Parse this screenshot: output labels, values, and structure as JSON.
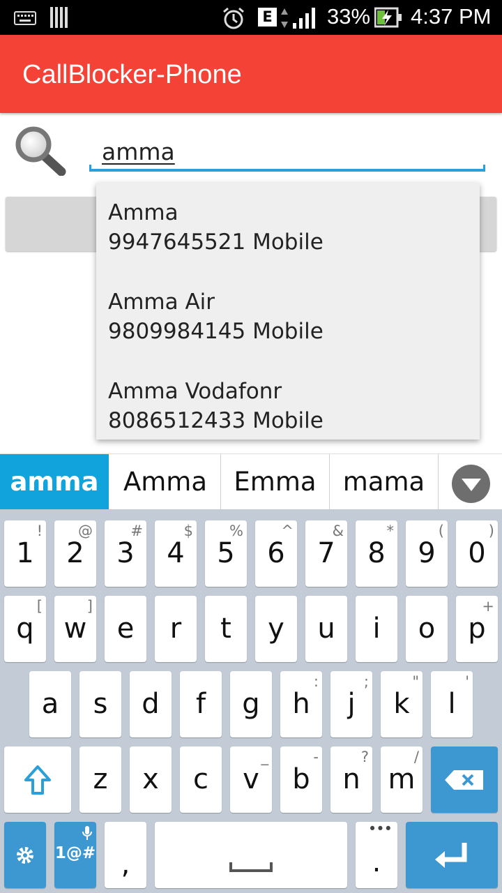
{
  "status_bar": {
    "battery": "33%",
    "time": "4:37 PM",
    "network_badge": "E"
  },
  "app": {
    "title": "CallBlocker-Phone"
  },
  "search": {
    "value": "amma"
  },
  "suggestions": [
    {
      "name": "Amma",
      "phone": "9947645521 Mobile"
    },
    {
      "name": "Amma Air",
      "phone": "9809984145 Mobile"
    },
    {
      "name": "Amma Vodafonr",
      "phone": "8086512433 Mobile"
    }
  ],
  "word_suggestions": [
    "amma",
    "Amma",
    "Emma",
    "mama"
  ],
  "keyboard": {
    "row1": [
      {
        "k": "1",
        "h": "!"
      },
      {
        "k": "2",
        "h": "@"
      },
      {
        "k": "3",
        "h": "#"
      },
      {
        "k": "4",
        "h": "$"
      },
      {
        "k": "5",
        "h": "%"
      },
      {
        "k": "6",
        "h": "^"
      },
      {
        "k": "7",
        "h": "&"
      },
      {
        "k": "8",
        "h": "*"
      },
      {
        "k": "9",
        "h": "("
      },
      {
        "k": "0",
        "h": ")"
      }
    ],
    "row2": [
      {
        "k": "q",
        "h": "["
      },
      {
        "k": "w",
        "h": "]"
      },
      {
        "k": "e",
        "h": ""
      },
      {
        "k": "r",
        "h": ""
      },
      {
        "k": "t",
        "h": ""
      },
      {
        "k": "y",
        "h": ""
      },
      {
        "k": "u",
        "h": ""
      },
      {
        "k": "i",
        "h": ""
      },
      {
        "k": "o",
        "h": ""
      },
      {
        "k": "p",
        "h": "+"
      }
    ],
    "row3": [
      {
        "k": "a",
        "h": ""
      },
      {
        "k": "s",
        "h": ""
      },
      {
        "k": "d",
        "h": ""
      },
      {
        "k": "f",
        "h": ""
      },
      {
        "k": "g",
        "h": ""
      },
      {
        "k": "h",
        "h": ":"
      },
      {
        "k": "j",
        "h": ";"
      },
      {
        "k": "k",
        "h": "\""
      },
      {
        "k": "l",
        "h": "'"
      }
    ],
    "row4": [
      {
        "k": "z",
        "h": ""
      },
      {
        "k": "x",
        "h": ""
      },
      {
        "k": "c",
        "h": ""
      },
      {
        "k": "v",
        "h": "_"
      },
      {
        "k": "b",
        "h": "-"
      },
      {
        "k": "n",
        "h": "?"
      },
      {
        "k": "m",
        "h": "/"
      }
    ],
    "symbols_label": "1@#",
    "comma": ",",
    "period": ".",
    "period_hint": "•••"
  },
  "colors": {
    "app_bar": "#f44336",
    "accent": "#2a9fd8",
    "keyboard_bg": "#c3ccd6",
    "selected_suggestion": "#11a3db"
  }
}
